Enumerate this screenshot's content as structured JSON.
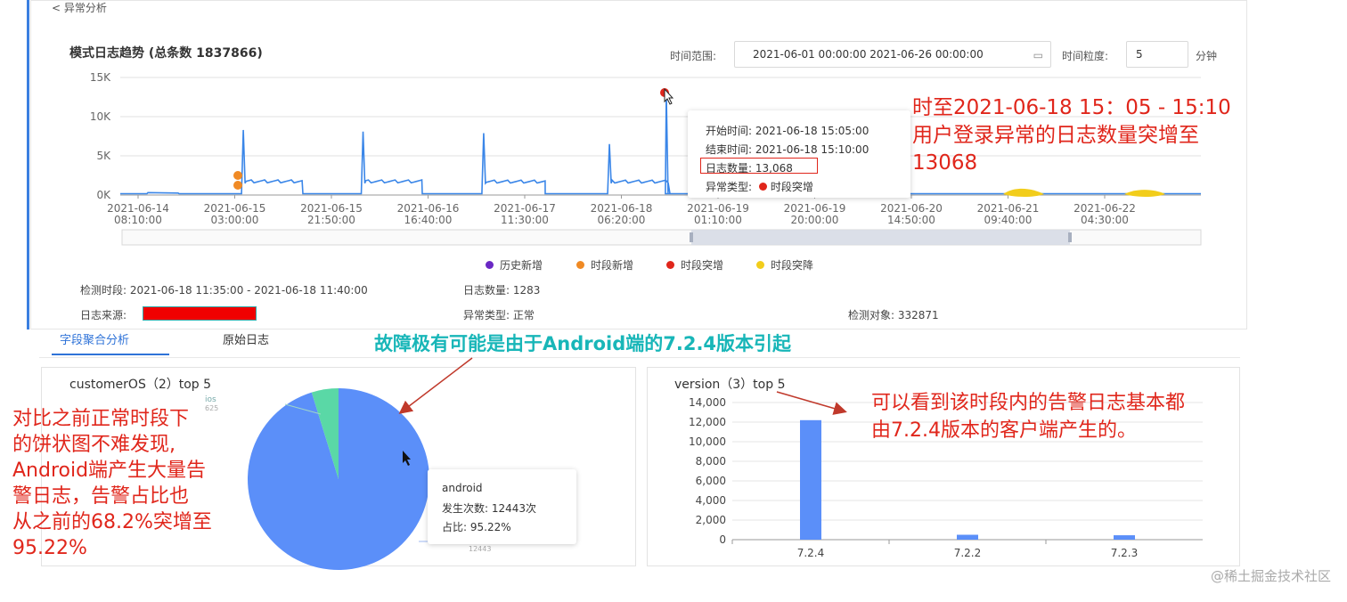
{
  "nav": {
    "back_label": "< 异常分析"
  },
  "chart_header": {
    "title": "模式日志趋势 (总条数 1837866)",
    "time_range_label": "时间范围:",
    "time_range_value": "2021-06-01 00:00:00 2021-06-26 00:00:00",
    "granularity_label": "时间粒度:",
    "granularity_value": "5",
    "granularity_unit": "分钟"
  },
  "chart_data": [
    {
      "type": "line",
      "y_ticks": [
        "15K",
        "10K",
        "5K",
        "0K"
      ],
      "ylim": [
        0,
        15000
      ],
      "x_ticks": [
        [
          "2021-06-14",
          "08:10:00"
        ],
        [
          "2021-06-15",
          "03:00:00"
        ],
        [
          "2021-06-15",
          "21:50:00"
        ],
        [
          "2021-06-16",
          "16:40:00"
        ],
        [
          "2021-06-17",
          "11:30:00"
        ],
        [
          "2021-06-18",
          "06:20:00"
        ],
        [
          "2021-06-19",
          "01:10:00"
        ],
        [
          "2021-06-19",
          "20:00:00"
        ],
        [
          "2021-06-20",
          "14:50:00"
        ],
        [
          "2021-06-21",
          "09:40:00"
        ],
        [
          "2021-06-22",
          "04:30:00"
        ]
      ],
      "peaks": [
        {
          "x": "2021-06-15 04:40",
          "y": 8300
        },
        {
          "x": "2021-06-16 04:00",
          "y": 8100
        },
        {
          "x": "2021-06-17 03:30",
          "y": 7900
        },
        {
          "x": "2021-06-18 04:00",
          "y": 6500
        },
        {
          "x": "2021-06-18 15:05",
          "y": 13068
        }
      ],
      "legend": [
        "历史新增",
        "时段新增",
        "时段突增",
        "时段突降"
      ],
      "legend_colors": [
        "#6a28c4",
        "#f08a24",
        "#e0261b",
        "#f2cd1b"
      ],
      "grid": true,
      "legend_position": "bottom"
    },
    {
      "type": "pie",
      "title": "customerOS（2）top 5",
      "labels": [
        "android",
        "ios"
      ],
      "values": [
        12443,
        625
      ],
      "percent": [
        95.22,
        4.78
      ],
      "colors": [
        "#5b8ff9",
        "#5ad8a6"
      ]
    },
    {
      "type": "bar",
      "title": "version（3）top 5",
      "categories": [
        "7.2.4",
        "7.2.2",
        "7.2.3"
      ],
      "values": [
        12200,
        500,
        450
      ],
      "ylim": [
        0,
        14000
      ],
      "y_ticks": [
        "14,000",
        "12,000",
        "10,000",
        "8,000",
        "6,000",
        "4,000",
        "2,000",
        "0"
      ],
      "color": "#5b8ff9"
    }
  ],
  "tooltip": {
    "start_label": "开始时间:",
    "start_value": "2021-06-18 15:05:00",
    "end_label": "结束时间:",
    "end_value": "2021-06-18 15:10:00",
    "count_label": "日志数量:",
    "count_value": "13,068",
    "type_label": "异常类型:",
    "type_value": "时段突增"
  },
  "info": {
    "period_label": "检测时段:",
    "period_value": "2021-06-18 11:35:00 - 2021-06-18 11:40:00",
    "log_count_label": "日志数量:",
    "log_count_value": "1283",
    "source_label": "日志来源:",
    "anomaly_type_label": "异常类型:",
    "anomaly_type_value": "正常",
    "target_label": "检测对象:",
    "target_value": "332871"
  },
  "tabs": [
    "字段聚合分析",
    "原始日志"
  ],
  "pie_tooltip": {
    "name": "android",
    "count_label": "发生次数:",
    "count_value": "12443次",
    "ratio_label": "占比:",
    "ratio_value": "95.22%"
  },
  "pie_side_labels": {
    "ios": "ios",
    "ios_count": "625",
    "android_count": "12443"
  },
  "annotations": {
    "right_top": [
      "时至2021-06-18 15：05 - 15:10",
      "用户登录异常的日志数量突增至",
      "13068"
    ],
    "teal": "故障极有可能是由于Android端的7.2.4版本引起",
    "left": [
      "对比之前正常时段下",
      "的饼状图不难发现,",
      "Android端产生大量告",
      "警日志，告警占比也",
      "从之前的68.2%突增至",
      "95.22%"
    ],
    "bar_note": [
      "可以看到该时段内的告警日志基本都",
      "由7.2.4版本的客户端产生的。"
    ]
  },
  "watermark": "@稀土掘金技术社区"
}
